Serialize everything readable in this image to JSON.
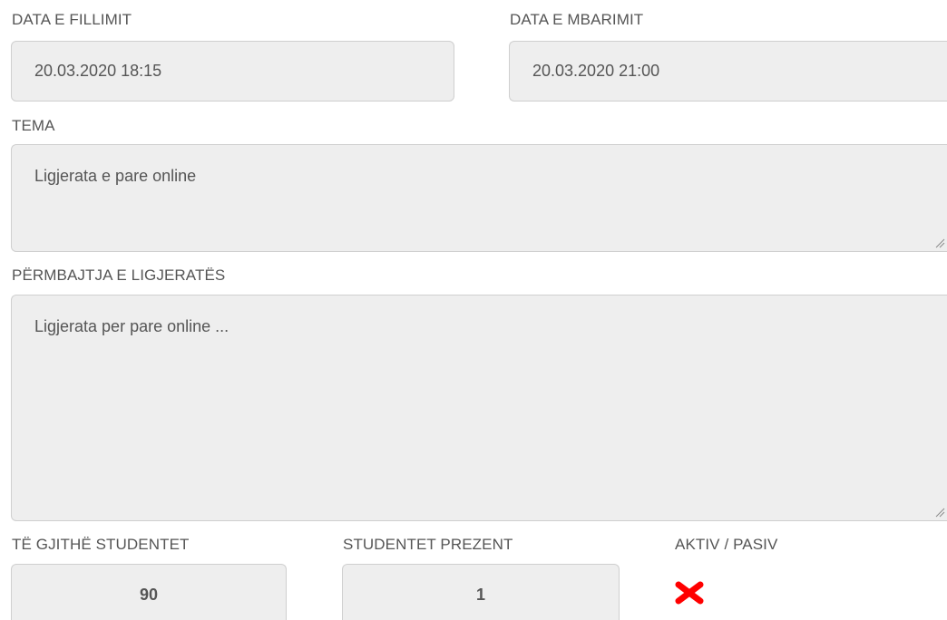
{
  "form": {
    "start_date": {
      "label": "DATA E FILLIMIT",
      "value": "20.03.2020 18:15"
    },
    "end_date": {
      "label": "DATA E MBARIMIT",
      "value": "20.03.2020 21:00"
    },
    "topic": {
      "label": "TEMA",
      "value": "Ligjerata e pare online"
    },
    "content": {
      "label": "PËRMBAJTJA E LIGJERATËS",
      "value": "Ligjerata per pare online ..."
    },
    "total_students": {
      "label": "TË GJITHË STUDENTET",
      "value": "90"
    },
    "present_students": {
      "label": "STUDENTET PREZENT",
      "value": "1"
    },
    "status": {
      "label": "AKTIV / PASIV",
      "icon": "cross-icon",
      "color": "#ff0000"
    }
  },
  "colors": {
    "field_background": "#eeeeee",
    "field_border": "#cfcfcf",
    "text": "#555555"
  }
}
